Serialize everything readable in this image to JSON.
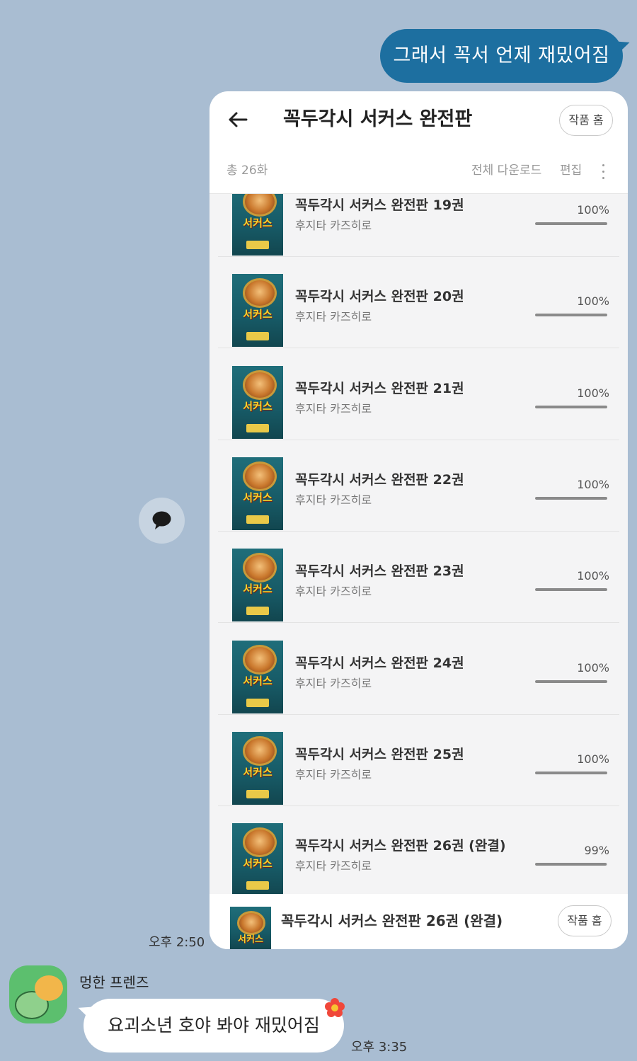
{
  "messages": {
    "outgoing_text": "그래서 꼭서 언제 재밌어짐",
    "shared_time": "오후 2:50",
    "sender_name": "멍한 프렌즈",
    "incoming_text": "요괴소년 호야 봐야 재밌어짐",
    "incoming_time": "오후 3:35"
  },
  "card": {
    "title": "꼭두각시 서커스 완전판",
    "work_home_label": "작품 홈",
    "total_label": "총 26화",
    "download_all_label": "전체 다운로드",
    "edit_label": "편집",
    "episodes": [
      {
        "title": "꼭두각시 서커스 완전판 19권",
        "author": "후지타 카즈히로",
        "progress_label": "100%",
        "progress": 100
      },
      {
        "title": "꼭두각시 서커스 완전판 20권",
        "author": "후지타 카즈히로",
        "progress_label": "100%",
        "progress": 100
      },
      {
        "title": "꼭두각시 서커스 완전판 21권",
        "author": "후지타 카즈히로",
        "progress_label": "100%",
        "progress": 100
      },
      {
        "title": "꼭두각시 서커스 완전판 22권",
        "author": "후지타 카즈히로",
        "progress_label": "100%",
        "progress": 100
      },
      {
        "title": "꼭두각시 서커스 완전판 23권",
        "author": "후지타 카즈히로",
        "progress_label": "100%",
        "progress": 100
      },
      {
        "title": "꼭두각시 서커스 완전판 24권",
        "author": "후지타 카즈히로",
        "progress_label": "100%",
        "progress": 100
      },
      {
        "title": "꼭두각시 서커스 완전판 25권",
        "author": "후지타 카즈히로",
        "progress_label": "100%",
        "progress": 100
      },
      {
        "title": "꼭두각시 서커스 완전판 26권 (완결)",
        "author": "후지타 카즈히로",
        "progress_label": "99%",
        "progress": 99
      }
    ],
    "cover_logo": "서커스",
    "footer": {
      "title": "꼭두각시 서커스 완전판 26권 (완결)",
      "work_home_label": "작품 홈"
    }
  },
  "colors": {
    "chat_background": "#a9bdd2",
    "outgoing_bubble": "#1d6fa0",
    "progress_fill": "#8a8a8a"
  },
  "icons": [
    "back-arrow-icon",
    "more-vertical-icon",
    "share-chat-icon",
    "flower-icon"
  ]
}
